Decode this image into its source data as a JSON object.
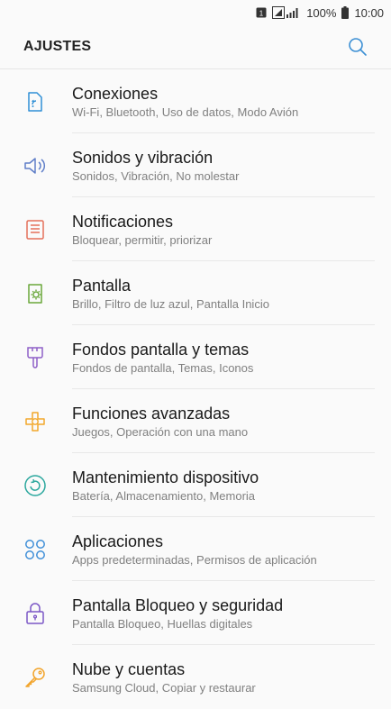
{
  "status_bar": {
    "battery": "100%",
    "time": "10:00"
  },
  "header": {
    "title": "AJUSTES",
    "search_icon": "search-icon"
  },
  "colors": {
    "accent": "#3b8fd4"
  },
  "items": [
    {
      "label": "Conexiones",
      "sub": "Wi-Fi, Bluetooth, Uso de datos, Modo Avión",
      "icon": "connections-icon",
      "color": "#2f90d6"
    },
    {
      "label": "Sonidos y vibración",
      "sub": "Sonidos, Vibración, No molestar",
      "icon": "sound-icon",
      "color": "#5f7ec8"
    },
    {
      "label": "Notificaciones",
      "sub": "Bloquear, permitir, priorizar",
      "icon": "notifications-icon",
      "color": "#e4705a"
    },
    {
      "label": "Pantalla",
      "sub": "Brillo, Filtro de luz azul, Pantalla Inicio",
      "icon": "display-icon",
      "color": "#6aa83b"
    },
    {
      "label": "Fondos pantalla y temas",
      "sub": "Fondos de pantalla, Temas, Iconos",
      "icon": "wallpaper-icon",
      "color": "#8e5fc7"
    },
    {
      "label": "Funciones avanzadas",
      "sub": "Juegos, Operación con una mano",
      "icon": "advanced-icon",
      "color": "#f2a72a"
    },
    {
      "label": "Mantenimiento dispositivo",
      "sub": "Batería, Almacenamiento, Memoria",
      "icon": "maintenance-icon",
      "color": "#2aa79d"
    },
    {
      "label": "Aplicaciones",
      "sub": "Apps predeterminadas, Permisos de aplicación",
      "icon": "apps-icon",
      "color": "#3f8fd8"
    },
    {
      "label": "Pantalla Bloqueo y seguridad",
      "sub": "Pantalla Bloqueo, Huellas digitales",
      "icon": "lock-icon",
      "color": "#7b56c6"
    },
    {
      "label": "Nube y cuentas",
      "sub": "Samsung Cloud, Copiar y restaurar",
      "icon": "key-icon",
      "color": "#f2a42a"
    }
  ]
}
